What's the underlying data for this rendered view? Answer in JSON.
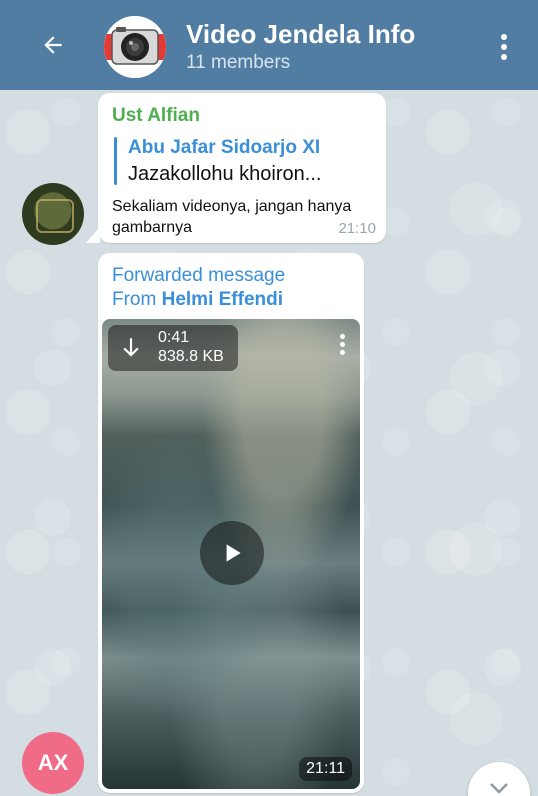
{
  "header": {
    "title": "Video Jendela Info",
    "subtitle": "11 members",
    "back_icon": "arrow-left-icon",
    "menu_icon": "more-vertical-icon",
    "color": "#517da2"
  },
  "messages": [
    {
      "sender": "Ust Alfian",
      "sender_color": "#4fae4e",
      "reply": {
        "name": "Abu Jafar Sidoarjo XI",
        "text": "Jazakollohu khoiron..."
      },
      "text": "Sekaliam videonya, jangan hanya gambarnya",
      "time": "21:10"
    },
    {
      "forwarded_label": "Forwarded message",
      "forwarded_from_prefix": "From",
      "forwarded_from": "Helmi Effendi",
      "video": {
        "duration": "0:41",
        "size": "838.8 KB",
        "time": "21:11",
        "download_icon": "download-arrow-icon",
        "play_icon": "play-icon"
      }
    }
  ],
  "bottom_avatar": {
    "initials": "AX",
    "color": "#ef6b86"
  },
  "scroll_button": {
    "icon": "chevron-down-icon"
  }
}
